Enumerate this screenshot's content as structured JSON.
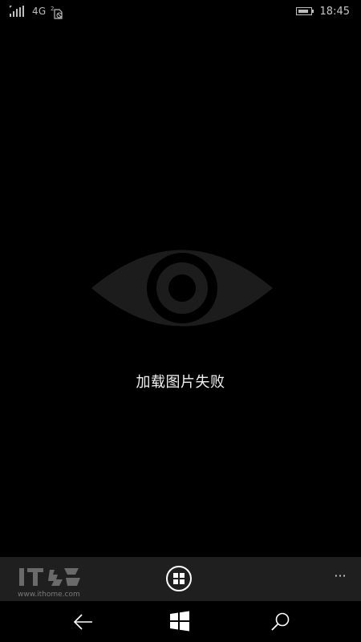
{
  "status_bar": {
    "network": "4G",
    "sim_badge": "2",
    "time": "18:45",
    "battery_level": 0.85,
    "icons": [
      "signal-icon",
      "sim-icon",
      "battery-icon"
    ]
  },
  "main": {
    "placeholder_icon": "eye-icon",
    "message": "加载图片失败"
  },
  "app_bar": {
    "watermark_logo": "IT之家",
    "watermark_url": "www.ithome.com",
    "home_icon": "grid-icon",
    "more_label": "···"
  },
  "nav_bar": {
    "back_icon": "back-arrow-icon",
    "start_icon": "windows-logo-icon",
    "search_icon": "search-icon"
  },
  "colors": {
    "background": "#000000",
    "eye": "#1c1c1c",
    "app_bar": "#1f1f1f",
    "text": "#f0f0f0",
    "status": "#bdbdbd"
  }
}
